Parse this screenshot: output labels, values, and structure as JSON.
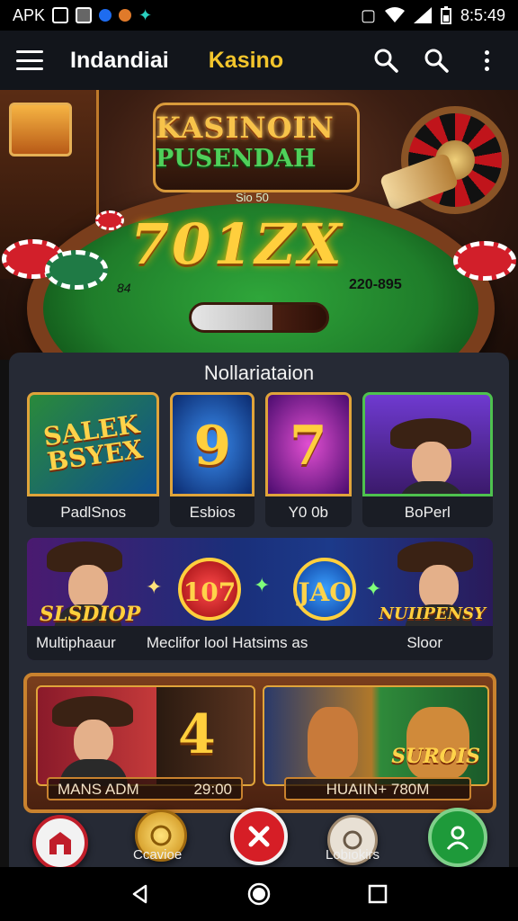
{
  "status_bar": {
    "left_text": "APK",
    "time": "8:5:49",
    "icons": [
      "m-box-icon",
      "square-icon",
      "blue-circle-icon",
      "orange-flower-icon",
      "teal-sparkle-icon",
      "vibrate-icon",
      "wifi-icon",
      "signal-icon",
      "battery-icon"
    ]
  },
  "app_bar": {
    "title": "Indandiai",
    "brand": "Kasino",
    "brand_color": "#f3c52c",
    "icons": [
      "menu-icon",
      "search-icon",
      "search-icon",
      "more-vert-icon"
    ]
  },
  "hero": {
    "sign_line1": "KASINOIN",
    "sign_line2": "PUSENDAH",
    "sub_label": "Sio 50",
    "jackpot": "701ZX",
    "left_value": "84",
    "right_value": "220-895"
  },
  "panel": {
    "title": "Nollariataion",
    "tiles": [
      {
        "art_text": "SALEK BSYEX",
        "label": "PadlSnos"
      },
      {
        "art_text": "9",
        "label": "Esbios"
      },
      {
        "art_text": "7",
        "label": "Y0 0b"
      },
      {
        "art_text": "",
        "label": "BoPerl"
      }
    ],
    "banner": {
      "word_left": "SLSDIOP",
      "coin1": "107",
      "coin2": "JAO",
      "word_right": "NUIIPENSY",
      "label_left": "Multiphaaur",
      "label_mid": "Meclifor lool Hatsims as",
      "label_right": "Sloor"
    },
    "frame": {
      "slot_number": "4",
      "slot_word": "SUROIS",
      "cap_a_left": "MANS ADM",
      "cap_a_right": "29:00",
      "cap_b": "HUAIIN+ 780M"
    }
  },
  "bottom_nav": {
    "coin_label": "Ccavioe",
    "rules_label": "Lobiokirs",
    "accent_red": "#d61e26",
    "accent_green": "#1e9a3a"
  }
}
